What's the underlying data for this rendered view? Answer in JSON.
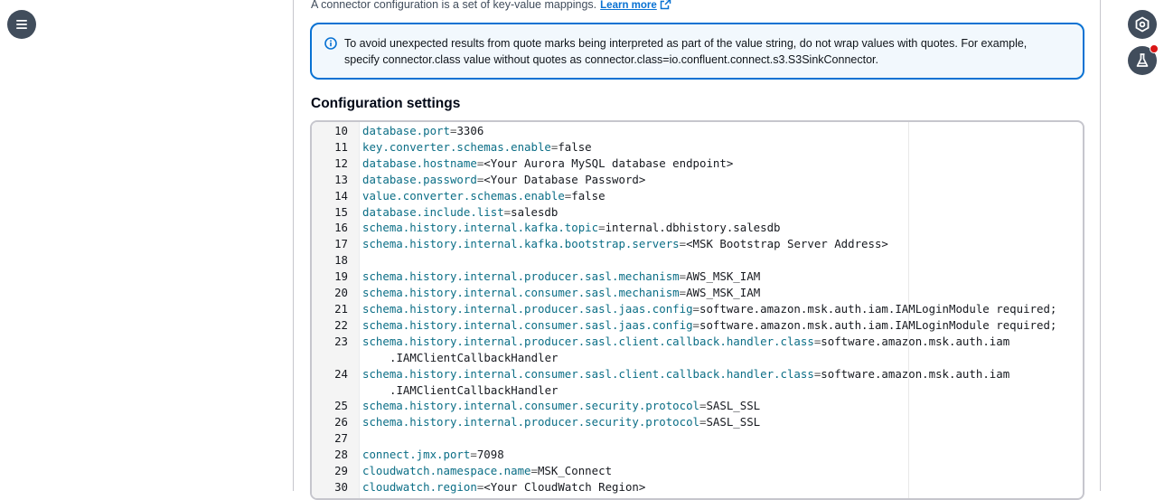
{
  "nav": {
    "menu_icon": "hamburger-menu-icon"
  },
  "rail": {
    "top_icon": "hexagon-settings-icon",
    "lab_icon": "flask-icon"
  },
  "description": {
    "text": "A connector configuration is a set of key-value mappings.",
    "link": "Learn more"
  },
  "alert": {
    "line1": "To avoid unexpected results from quote marks being interpreted as part of the value string, do not wrap values with quotes. For example,",
    "line2": "specify connector.class value without quotes as connector.class=io.confluent.connect.s3.S3SinkConnector."
  },
  "section_title": "Configuration settings",
  "editor": {
    "lines": [
      {
        "n": "10",
        "k": "database.port",
        "v": "3306"
      },
      {
        "n": "11",
        "k": "key.converter.schemas.enable",
        "v": "false"
      },
      {
        "n": "12",
        "k": "database.hostname",
        "v": "<Your Aurora MySQL database endpoint>"
      },
      {
        "n": "13",
        "k": "database.password",
        "v": "<Your Database Password>"
      },
      {
        "n": "14",
        "k": "value.converter.schemas.enable",
        "v": "false"
      },
      {
        "n": "15",
        "k": "database.include.list",
        "v": "salesdb"
      },
      {
        "n": "16",
        "k": "schema.history.internal.kafka.topic",
        "v": "internal.dbhistory.salesdb"
      },
      {
        "n": "17",
        "k": "schema.history.internal.kafka.bootstrap.servers",
        "v": "<MSK Bootstrap Server Address>"
      },
      {
        "n": "18",
        "k": "",
        "v": ""
      },
      {
        "n": "19",
        "k": "schema.history.internal.producer.sasl.mechanism",
        "v": "AWS_MSK_IAM"
      },
      {
        "n": "20",
        "k": "schema.history.internal.consumer.sasl.mechanism",
        "v": "AWS_MSK_IAM"
      },
      {
        "n": "21",
        "k": "schema.history.internal.producer.sasl.jaas.config",
        "v": "software.amazon.msk.auth.iam.IAMLoginModule required;"
      },
      {
        "n": "22",
        "k": "schema.history.internal.consumer.sasl.jaas.config",
        "v": "software.amazon.msk.auth.iam.IAMLoginModule required;"
      },
      {
        "n": "23",
        "k": "schema.history.internal.producer.sasl.client.callback.handler.class",
        "v": "software.amazon.msk.auth.iam",
        "wrap": ".IAMClientCallbackHandler"
      },
      {
        "n": "24",
        "k": "schema.history.internal.consumer.sasl.client.callback.handler.class",
        "v": "software.amazon.msk.auth.iam",
        "wrap": ".IAMClientCallbackHandler"
      },
      {
        "n": "25",
        "k": "schema.history.internal.consumer.security.protocol",
        "v": "SASL_SSL"
      },
      {
        "n": "26",
        "k": "schema.history.internal.producer.security.protocol",
        "v": "SASL_SSL"
      },
      {
        "n": "27",
        "k": "",
        "v": ""
      },
      {
        "n": "28",
        "k": "connect.jmx.port",
        "v": "7098"
      },
      {
        "n": "29",
        "k": "cloudwatch.namespace.name",
        "v": "MSK_Connect"
      },
      {
        "n": "30",
        "k": "cloudwatch.region",
        "v": "<Your CloudWatch Region>"
      }
    ]
  },
  "colors": {
    "accent": "#0972d3",
    "alert_bg": "#f2f8fd",
    "key": "#0b6e86",
    "notif": "#d91515"
  }
}
